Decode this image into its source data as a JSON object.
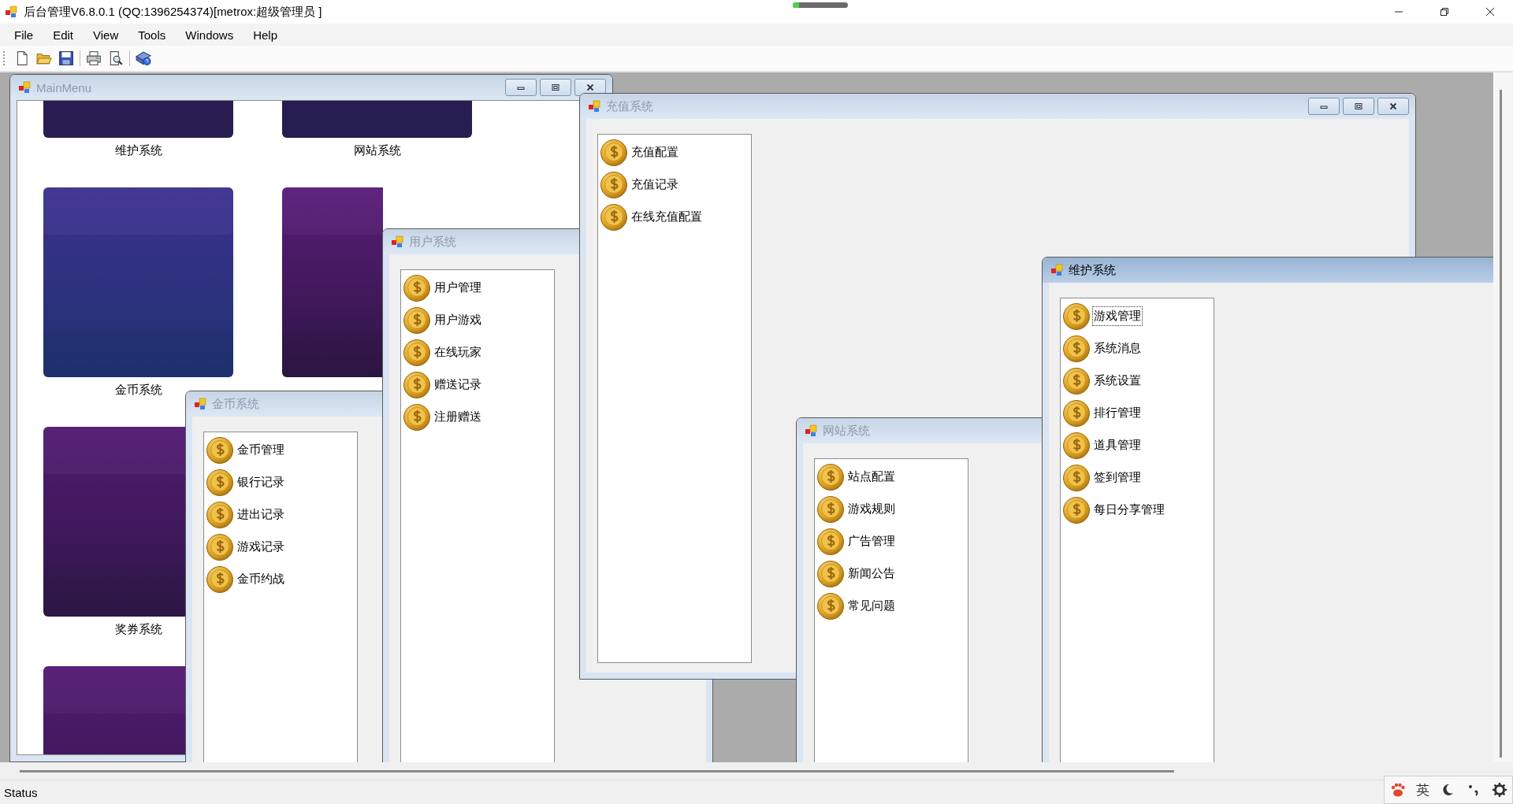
{
  "app": {
    "title": "后台管理V6.8.0.1 (QQ:1396254374)[metrox:超级管理员 ]"
  },
  "capture_indicator": {
    "level": 0.12
  },
  "menu": [
    "File",
    "Edit",
    "View",
    "Tools",
    "Windows",
    "Help"
  ],
  "toolbar": [
    {
      "kind": "new"
    },
    {
      "kind": "open"
    },
    {
      "kind": "save"
    },
    {
      "kind": "separator"
    },
    {
      "kind": "print"
    },
    {
      "kind": "preview"
    },
    {
      "kind": "separator"
    },
    {
      "kind": "help"
    }
  ],
  "main_menu": {
    "title": "MainMenu",
    "active": false,
    "has_controls": true,
    "tiles": [
      {
        "kind": "picture",
        "label": "维护系统"
      },
      {
        "kind": "picture",
        "label": "网站系统"
      },
      {
        "kind": "picture",
        "label": "金币系统"
      },
      {
        "kind": "picture"
      },
      {
        "kind": "picture",
        "label": "奖券系统"
      },
      {
        "kind": "empty"
      },
      {
        "kind": "picture"
      }
    ]
  },
  "windows": [
    {
      "title": "金币系统",
      "active": false,
      "items": [
        {
          "label": "金币管理",
          "focused": false
        },
        {
          "label": "银行记录",
          "focused": false
        },
        {
          "label": "进出记录",
          "focused": false
        },
        {
          "label": "游戏记录",
          "focused": false
        },
        {
          "label": "金币约战",
          "focused": false
        }
      ]
    },
    {
      "title": "用户系统",
      "active": false,
      "items": [
        {
          "label": "用户管理",
          "focused": false
        },
        {
          "label": "用户游戏",
          "focused": false
        },
        {
          "label": "在线玩家",
          "focused": false
        },
        {
          "label": "赠送记录",
          "focused": false
        },
        {
          "label": "注册赠送",
          "focused": false
        }
      ]
    },
    {
      "title": "充值系统",
      "active": false,
      "has_controls": true,
      "items": [
        {
          "label": "充值配置",
          "focused": false
        },
        {
          "label": "充值记录",
          "focused": false
        },
        {
          "label": "在线充值配置",
          "focused": false
        }
      ]
    },
    {
      "title": "网站系统",
      "active": false,
      "items": [
        {
          "label": "站点配置",
          "focused": false
        },
        {
          "label": "游戏规则",
          "focused": false
        },
        {
          "label": "广告管理",
          "focused": false
        },
        {
          "label": "新闻公告",
          "focused": false
        },
        {
          "label": "常见问题",
          "focused": false
        }
      ]
    },
    {
      "title": "维护系统",
      "active": true,
      "items": [
        {
          "label": "游戏管理",
          "focused": true
        },
        {
          "label": "系统消息",
          "focused": false
        },
        {
          "label": "系统设置",
          "focused": false
        },
        {
          "label": "排行管理",
          "focused": false
        },
        {
          "label": "道具管理",
          "focused": false
        },
        {
          "label": "签到管理",
          "focused": false
        },
        {
          "label": "每日分享管理",
          "focused": false
        }
      ]
    }
  ],
  "status_bar": {
    "text": "Status"
  },
  "ime_bar": {
    "mode": "英"
  }
}
